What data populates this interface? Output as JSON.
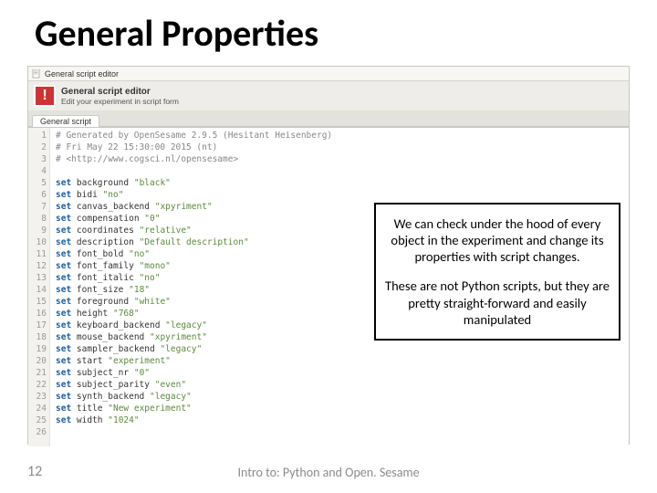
{
  "title": "General Properties",
  "window_title": "General script editor",
  "header": {
    "title": "General script editor",
    "subtitle": "Edit your experiment in script form"
  },
  "tab": "General script",
  "code": [
    {
      "t": "cmt",
      "text": "# Generated by OpenSesame 2.9.5 (Hesitant Heisenberg)"
    },
    {
      "t": "cmt",
      "text": "# Fri May 22 15:30:00 2015 (nt)"
    },
    {
      "t": "cmt",
      "text": "# <http://www.cogsci.nl/opensesame>"
    },
    {
      "t": "blank",
      "text": ""
    },
    {
      "t": "set",
      "name": "background",
      "val": "\"black\""
    },
    {
      "t": "set",
      "name": "bidi",
      "val": "\"no\""
    },
    {
      "t": "set",
      "name": "canvas_backend",
      "val": "\"xpyriment\""
    },
    {
      "t": "set",
      "name": "compensation",
      "val": "\"0\""
    },
    {
      "t": "set",
      "name": "coordinates",
      "val": "\"relative\""
    },
    {
      "t": "set",
      "name": "description",
      "val": "\"Default description\""
    },
    {
      "t": "set",
      "name": "font_bold",
      "val": "\"no\""
    },
    {
      "t": "set",
      "name": "font_family",
      "val": "\"mono\""
    },
    {
      "t": "set",
      "name": "font_italic",
      "val": "\"no\""
    },
    {
      "t": "set",
      "name": "font_size",
      "val": "\"18\""
    },
    {
      "t": "set",
      "name": "foreground",
      "val": "\"white\""
    },
    {
      "t": "set",
      "name": "height",
      "val": "\"768\""
    },
    {
      "t": "set",
      "name": "keyboard_backend",
      "val": "\"legacy\""
    },
    {
      "t": "set",
      "name": "mouse_backend",
      "val": "\"xpyriment\""
    },
    {
      "t": "set",
      "name": "sampler_backend",
      "val": "\"legacy\""
    },
    {
      "t": "set",
      "name": "start",
      "val": "\"experiment\""
    },
    {
      "t": "set",
      "name": "subject_nr",
      "val": "\"0\""
    },
    {
      "t": "set",
      "name": "subject_parity",
      "val": "\"even\""
    },
    {
      "t": "set",
      "name": "synth_backend",
      "val": "\"legacy\""
    },
    {
      "t": "set",
      "name": "title",
      "val": "\"New experiment\""
    },
    {
      "t": "set",
      "name": "width",
      "val": "\"1024\""
    },
    {
      "t": "blank",
      "text": ""
    }
  ],
  "callout": {
    "p1": "We can check under the hood of every object in the experiment and change its properties with script changes.",
    "p2": "These are not Python scripts, but they are pretty straight-forward and easily manipulated"
  },
  "footer": {
    "page": "12",
    "center": "Intro to: Python and Open. Sesame"
  }
}
